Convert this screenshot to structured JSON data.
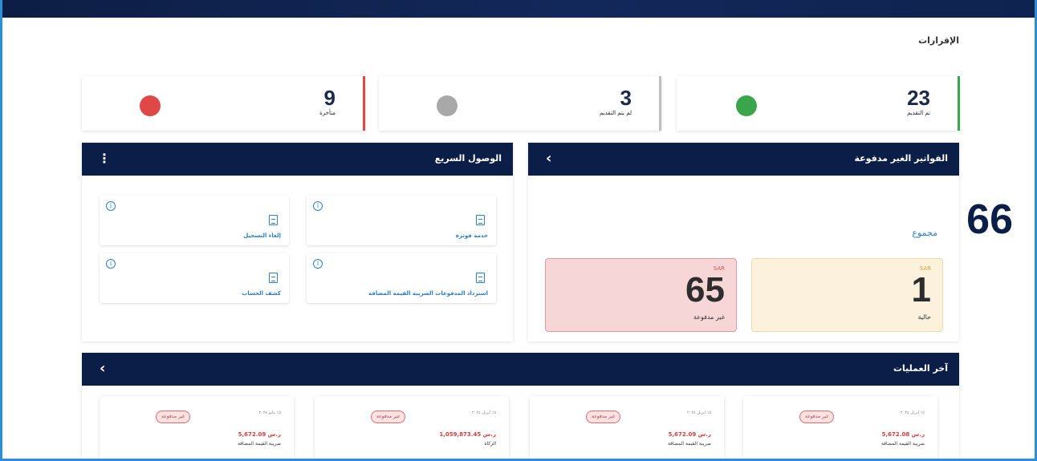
{
  "header": {
    "page_title": "الإقرارات"
  },
  "stats": [
    {
      "value": "23",
      "label": "تم التقديم",
      "color": "#3aa54a"
    },
    {
      "value": "3",
      "label": "لم يتم التقديم",
      "color": "#a8a8a8"
    },
    {
      "value": "9",
      "label": "متأخرة",
      "color": "#e04747"
    }
  ],
  "unpaid": {
    "title": "الفواتير الغير مدفوعة",
    "chevron": "‹",
    "total": "66",
    "total_label": "مجموع",
    "current": {
      "currency": "SAR",
      "value": "1",
      "label": "حالية"
    },
    "overdue": {
      "currency": "SAR",
      "value": "65",
      "label": "غير مدفوعة"
    }
  },
  "quick_access": {
    "title": "الوصول السريع",
    "menu": "⋮",
    "items": [
      {
        "label": "خدمة فوترة"
      },
      {
        "label": "إلغاء التسجيل"
      },
      {
        "label": "استرداد المدفوعات الضريبة القيمة المضافة"
      },
      {
        "label": "كشف الحساب"
      }
    ]
  },
  "operations": {
    "title": "آخر العمليات",
    "chevron": "‹",
    "items": [
      {
        "date": "١٥ أبريل ٢٠٢٤",
        "amount": "5,672.08 ر.س",
        "type": "ضريبة القيمة المضافة",
        "status": "غير مدفوعة"
      },
      {
        "date": "١٥ أبريل ٢٠٢٤",
        "amount": "5,672.09 ر.س",
        "type": "ضريبة القيمة المضافة",
        "status": "غير مدفوعة"
      },
      {
        "date": "١٥ أبريل ٢٠٢٤",
        "amount": "1,059,873.45 ر.س",
        "type": "الزكاة",
        "status": "غير مدفوعة"
      },
      {
        "date": "١٥ مايو ٢٠٢٤",
        "amount": "5,672.09 ر.س",
        "type": "ضريبة القيمة المضافة",
        "status": "غير مدفوعة"
      }
    ]
  },
  "colors": {
    "navy": "#0b1e47",
    "accent_blue": "#2a7fc9",
    "current_bg": "#fbf1dc",
    "overdue_bg": "#f6d6d6"
  }
}
